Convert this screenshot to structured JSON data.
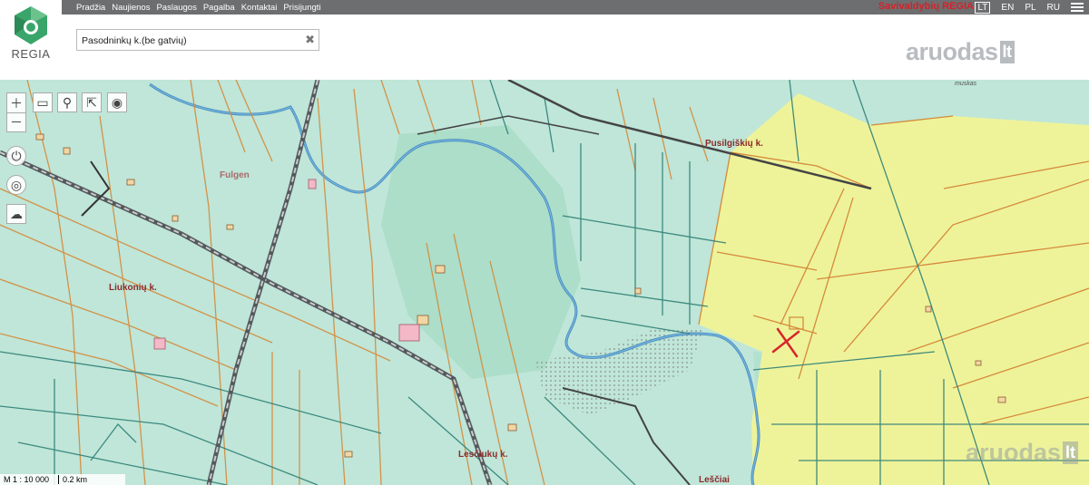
{
  "header": {
    "logo_text": "REGIA",
    "nav": [
      "Pradžia",
      "Naujienos",
      "Paslaugos",
      "Pagalba",
      "Kontaktai",
      "Prisijungti"
    ],
    "brand": "Savivaldybių REGIA",
    "languages": [
      "LT",
      "EN",
      "PL",
      "RU"
    ],
    "active_language": "LT"
  },
  "search": {
    "value": "Pasodninkų k.(be gatvių)"
  },
  "watermark": {
    "text": "aruodas",
    "suffix": "lt"
  },
  "map": {
    "place_names": {
      "fulgen": "Fulgen",
      "liukoniu": "Liukonių k.",
      "pusilgiskiu": "Pusilgiškių k.",
      "lesciuku": "Lesčiukų k.",
      "lesciai": "Leščiai",
      "muskas": "muskas"
    },
    "scale": {
      "ratio": "M 1 : 10 000",
      "distance": "0.2 km"
    }
  },
  "colors": {
    "parcel_green": "#bfe6d8",
    "parcel_yellow": "#eef39a",
    "boundary_orange": "#d58a3a",
    "boundary_teal": "#2f7f77",
    "river": "#4a8ec2",
    "marker": "#d8242b",
    "brand_red": "#d2232a"
  }
}
